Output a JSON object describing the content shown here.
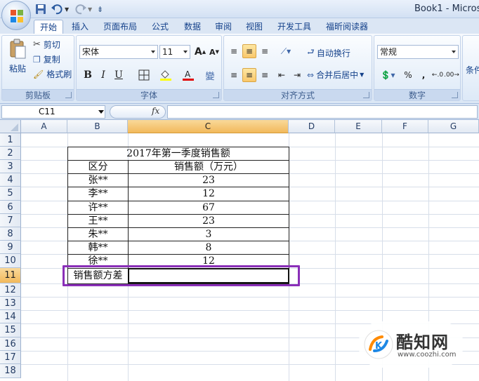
{
  "window": {
    "title": "Book1 - Micros"
  },
  "tabs": [
    "开始",
    "插入",
    "页面布局",
    "公式",
    "数据",
    "审阅",
    "视图",
    "开发工具",
    "福昕阅读器"
  ],
  "ribbon": {
    "clipboard": {
      "paste": "粘贴",
      "cut": "剪切",
      "copy": "复制",
      "format_painter": "格式刷",
      "label": "剪贴板"
    },
    "font": {
      "name": "宋体",
      "size": "11",
      "bold": "B",
      "italic": "I",
      "underline": "U",
      "label": "字体",
      "grow": "A",
      "shrink": "A"
    },
    "alignment": {
      "wrap": "自动换行",
      "merge": "合并后居中",
      "label": "对齐方式"
    },
    "number": {
      "format": "常规",
      "percent": "%",
      "comma": ",",
      "label": "数字"
    },
    "styles": {
      "cond_label": "条件"
    }
  },
  "formula_bar": {
    "name_box": "C11",
    "fx": "fx",
    "content": ""
  },
  "columns": [
    "A",
    "B",
    "C",
    "D",
    "E",
    "F",
    "G"
  ],
  "rows": [
    "1",
    "2",
    "3",
    "4",
    "5",
    "6",
    "7",
    "8",
    "9",
    "10",
    "11",
    "12",
    "13",
    "14",
    "15",
    "16",
    "17",
    "18"
  ],
  "active": {
    "column": "C",
    "row": "11"
  },
  "sheet": {
    "title": "2017年第一季度销售额",
    "header_b": "区分",
    "header_c": "销售额（万元）",
    "rows": [
      {
        "name": "张**",
        "value": "23"
      },
      {
        "name": "李**",
        "value": "12"
      },
      {
        "name": "许**",
        "value": "67"
      },
      {
        "name": "王**",
        "value": "23"
      },
      {
        "name": "朱**",
        "value": "3"
      },
      {
        "name": "韩**",
        "value": "8"
      },
      {
        "name": "徐**",
        "value": "12"
      }
    ],
    "footer_label": "销售额方差",
    "footer_value": ""
  },
  "watermark": {
    "brand": "酷知网",
    "url": "www.coozhi.com"
  },
  "colors": {
    "highlight": "#8a2fb8",
    "active_header": "#f2b95b",
    "ribbon_text": "#15428b"
  }
}
